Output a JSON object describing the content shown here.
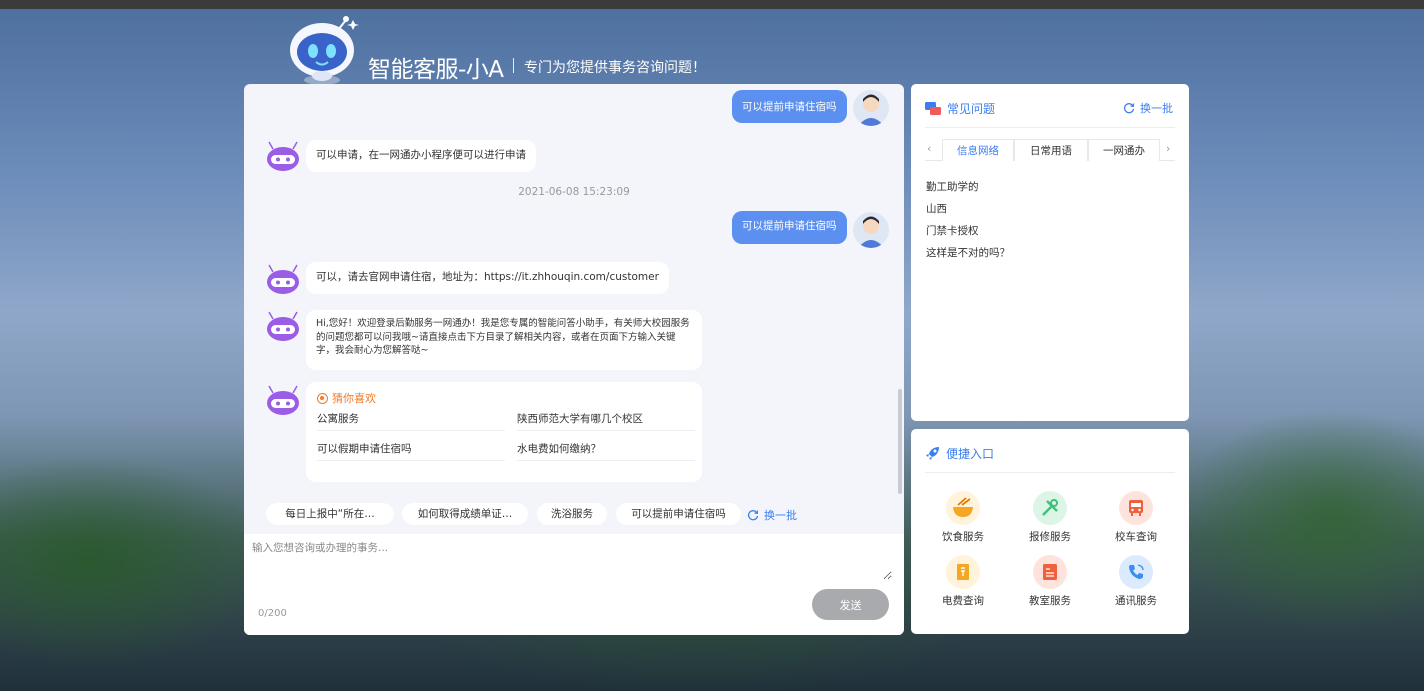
{
  "header": {
    "title": "智能客服-小A",
    "subtitle": "专门为您提供事务咨询问题！"
  },
  "chat": {
    "messages": {
      "user_partial": "可以提前申请住宿吗",
      "bot_reply_1": "可以申请，在一网通办小程序便可以进行申请",
      "timestamp": "2021-06-08 15:23:09",
      "user_msg": "可以提前申请住宿吗",
      "bot_reply_2": "可以，请去官网申请住宿，地址为：https://it.zhhouqin.com/customer",
      "bot_welcome": "Hi,您好！欢迎登录后勤服务一网通办！我是您专属的智能问答小助手，有关师大校园服务的问题您都可以问我哦~请直接点击下方目录了解相关内容，或者在页面下方输入关键字，我会耐心为您解答哒~"
    },
    "guess": {
      "title": "猜你喜欢",
      "items": [
        "公寓服务",
        "陕西师范大学有哪几个校区",
        "可以假期申请住宿吗",
        "水电费如何缴纳？"
      ]
    },
    "quick_chips": [
      "每日上报中“所在…",
      "如何取得成绩单证…",
      "洗浴服务",
      "可以提前申请住宿吗"
    ],
    "refresh_label": "换一批",
    "input": {
      "placeholder": "输入您想咨询或办理的事务...",
      "value": "",
      "char_count": "0/200"
    },
    "send_label": "发送"
  },
  "faq": {
    "title": "常见问题",
    "refresh_label": "换一批",
    "tabs": [
      "信息网络",
      "日常用语",
      "一网通办"
    ],
    "active_tab": "信息网络",
    "items": [
      "勤工助学的",
      "山西",
      "门禁卡授权",
      "这样是不对的吗？"
    ]
  },
  "quick_entry": {
    "title": "便捷入口",
    "services": [
      {
        "label": "饮食服务",
        "icon": "food-bowl-icon",
        "color": "#f5a623"
      },
      {
        "label": "报修服务",
        "icon": "repair-tools-icon",
        "color": "#3cc07a"
      },
      {
        "label": "校车查询",
        "icon": "bus-icon",
        "color": "#f0603c"
      },
      {
        "label": "电费查询",
        "icon": "bill-icon",
        "color": "#f5a623"
      },
      {
        "label": "教室服务",
        "icon": "classroom-icon",
        "color": "#f0603c"
      },
      {
        "label": "通讯服务",
        "icon": "phone-icon",
        "color": "#3a8ef0"
      }
    ]
  },
  "colors": {
    "accent": "#3a7ef0",
    "user_bubble": "#5b8ff0",
    "send_button": "#a9aaae",
    "guess_title": "#f37b2a"
  }
}
